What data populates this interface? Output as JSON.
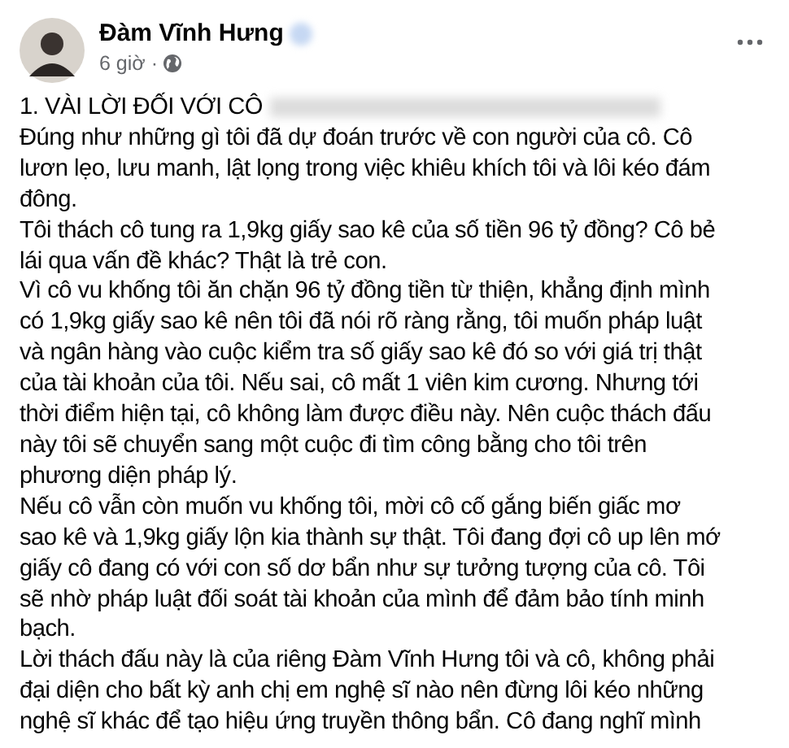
{
  "post": {
    "author": "Đàm Vĩnh Hưng",
    "time": "6 giờ ·",
    "heading": "1. VÀI LỜI ĐỐI VỚI CÔ",
    "paragraphs": [
      [
        "Đúng như những gì tôi đã dự đoán trước về con người của cô. Cô",
        "lươn lẹo, lưu manh, lật lọng trong việc khiêu khích tôi và lôi kéo đám",
        "đông."
      ],
      [
        "Tôi thách cô tung ra 1,9kg giấy sao kê của số tiền 96 tỷ đồng? Cô bẻ",
        "lái qua vấn đề khác? Thật là trẻ con."
      ],
      [
        "Vì cô vu khống tôi ăn chặn 96 tỷ đồng tiền từ thiện, khẳng định mình",
        "có 1,9kg giấy sao kê nên tôi đã nói rõ ràng rằng, tôi muốn pháp luật",
        "và ngân hàng vào cuộc kiểm tra số giấy sao kê đó so với giá trị thật",
        "của tài khoản của tôi. Nếu sai, cô mất 1 viên kim cương. Nhưng tới",
        "thời điểm hiện tại, cô không làm được điều này. Nên cuộc thách đấu",
        "này tôi sẽ chuyển sang một cuộc đi tìm công bằng cho tôi trên",
        "phương diện pháp lý."
      ],
      [
        "Nếu cô vẫn còn muốn vu khống tôi, mời cô cố gắng biến giấc mơ",
        "sao kê và 1,9kg giấy lộn kia thành sự thật. Tôi đang đợi cô up lên mớ",
        "giấy cô đang có với con số dơ bẩn như sự tưởng tượng của cô. Tôi",
        "sẽ nhờ pháp luật đối soát tài khoản của mình để đảm bảo tính minh",
        "bạch."
      ],
      [
        "Lời thách đấu này là của riêng Đàm Vĩnh Hưng tôi và cô, không phải",
        "đại diện cho bất kỳ anh chị em nghệ sĩ nào nên đừng lôi kéo những",
        "nghệ sĩ khác để tạo hiệu ứng truyền thông bẩn. Cô đang nghĩ mình"
      ]
    ]
  }
}
